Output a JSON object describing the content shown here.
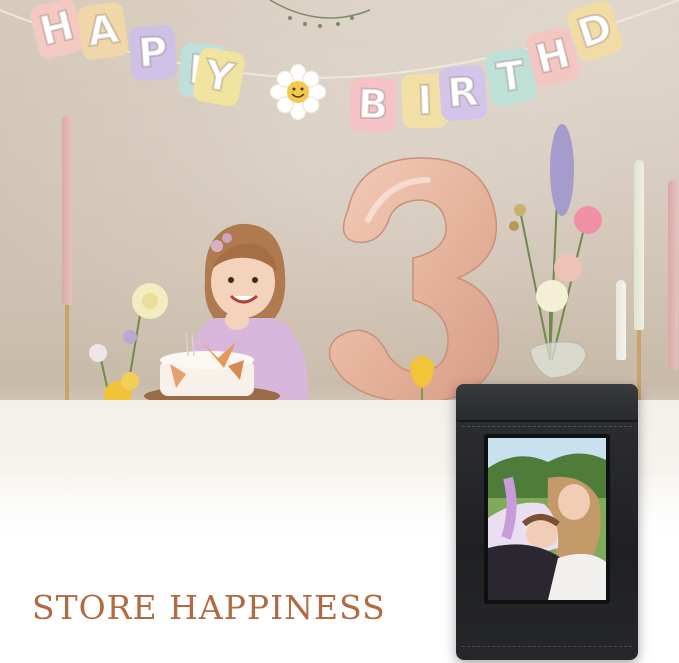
{
  "banner": {
    "letters": [
      "H",
      "A",
      "P",
      "P",
      "Y",
      "B",
      "I",
      "R",
      "T",
      "H",
      "D"
    ],
    "colors": [
      "#f3c9c1",
      "#f0d7a8",
      "#cfc0e6",
      "#bfe0d8",
      "#f0e4a0",
      "#f4c2c7",
      "#f2dfa6",
      "#d3c4ea",
      "#bfe0d6",
      "#f3c6c1",
      "#f0dca4"
    ]
  },
  "balloon_number": "3",
  "headline": "STORE HAPPINESS",
  "colors": {
    "headline": "#b26a44",
    "album": "#242528",
    "balloon": "#e9b9a5"
  }
}
